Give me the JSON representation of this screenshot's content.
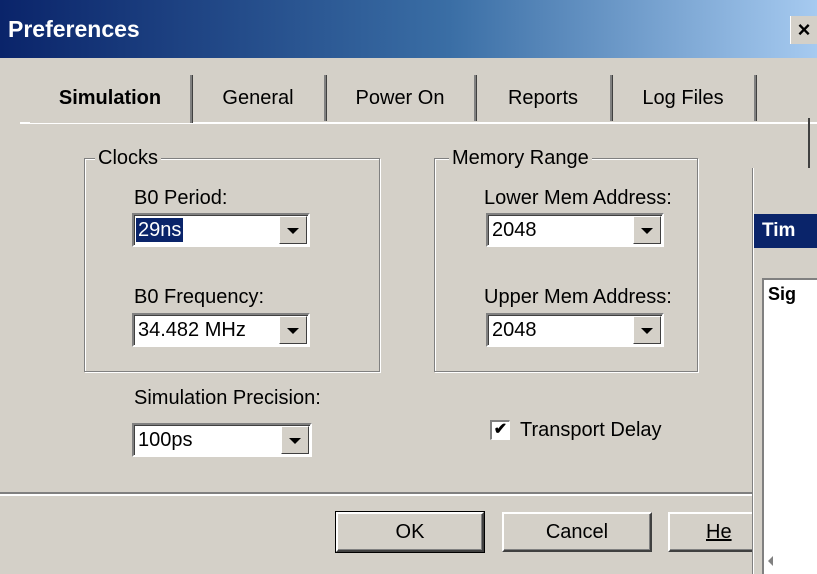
{
  "window": {
    "title": "Preferences",
    "close_glyph": "×"
  },
  "tabs": [
    {
      "label": "Simulation",
      "active": true
    },
    {
      "label": "General",
      "active": false
    },
    {
      "label": "Power On",
      "active": false
    },
    {
      "label": "Reports",
      "active": false
    },
    {
      "label": "Log Files",
      "active": false
    }
  ],
  "clocks": {
    "legend": "Clocks",
    "b0_period_label": "B0 Period:",
    "b0_period_value": "29ns",
    "b0_frequency_label": "B0 Frequency:",
    "b0_frequency_value": "34.482 MHz"
  },
  "memory": {
    "legend": "Memory Range",
    "lower_label": "Lower Mem Address:",
    "lower_value": "2048",
    "upper_label": "Upper Mem Address:",
    "upper_value": "2048"
  },
  "precision": {
    "label": "Simulation Precision:",
    "value": "100ps"
  },
  "transport_delay": {
    "label": "Transport Delay",
    "checked": true,
    "check_glyph": "✔"
  },
  "buttons": {
    "ok": "OK",
    "cancel": "Cancel",
    "help": "He"
  },
  "overlay": {
    "title": "Tim",
    "list_header": "Sig"
  },
  "icons": {
    "close": "close-icon",
    "dropdown": "chevron-down-icon",
    "check": "checkmark-icon",
    "scroll_left": "scroll-left-arrow-icon"
  },
  "colors": {
    "title_bar_start": "#0a246a",
    "title_bar_end": "#a6caf0",
    "face": "#d4d0c8",
    "selection": "#0a246a"
  }
}
